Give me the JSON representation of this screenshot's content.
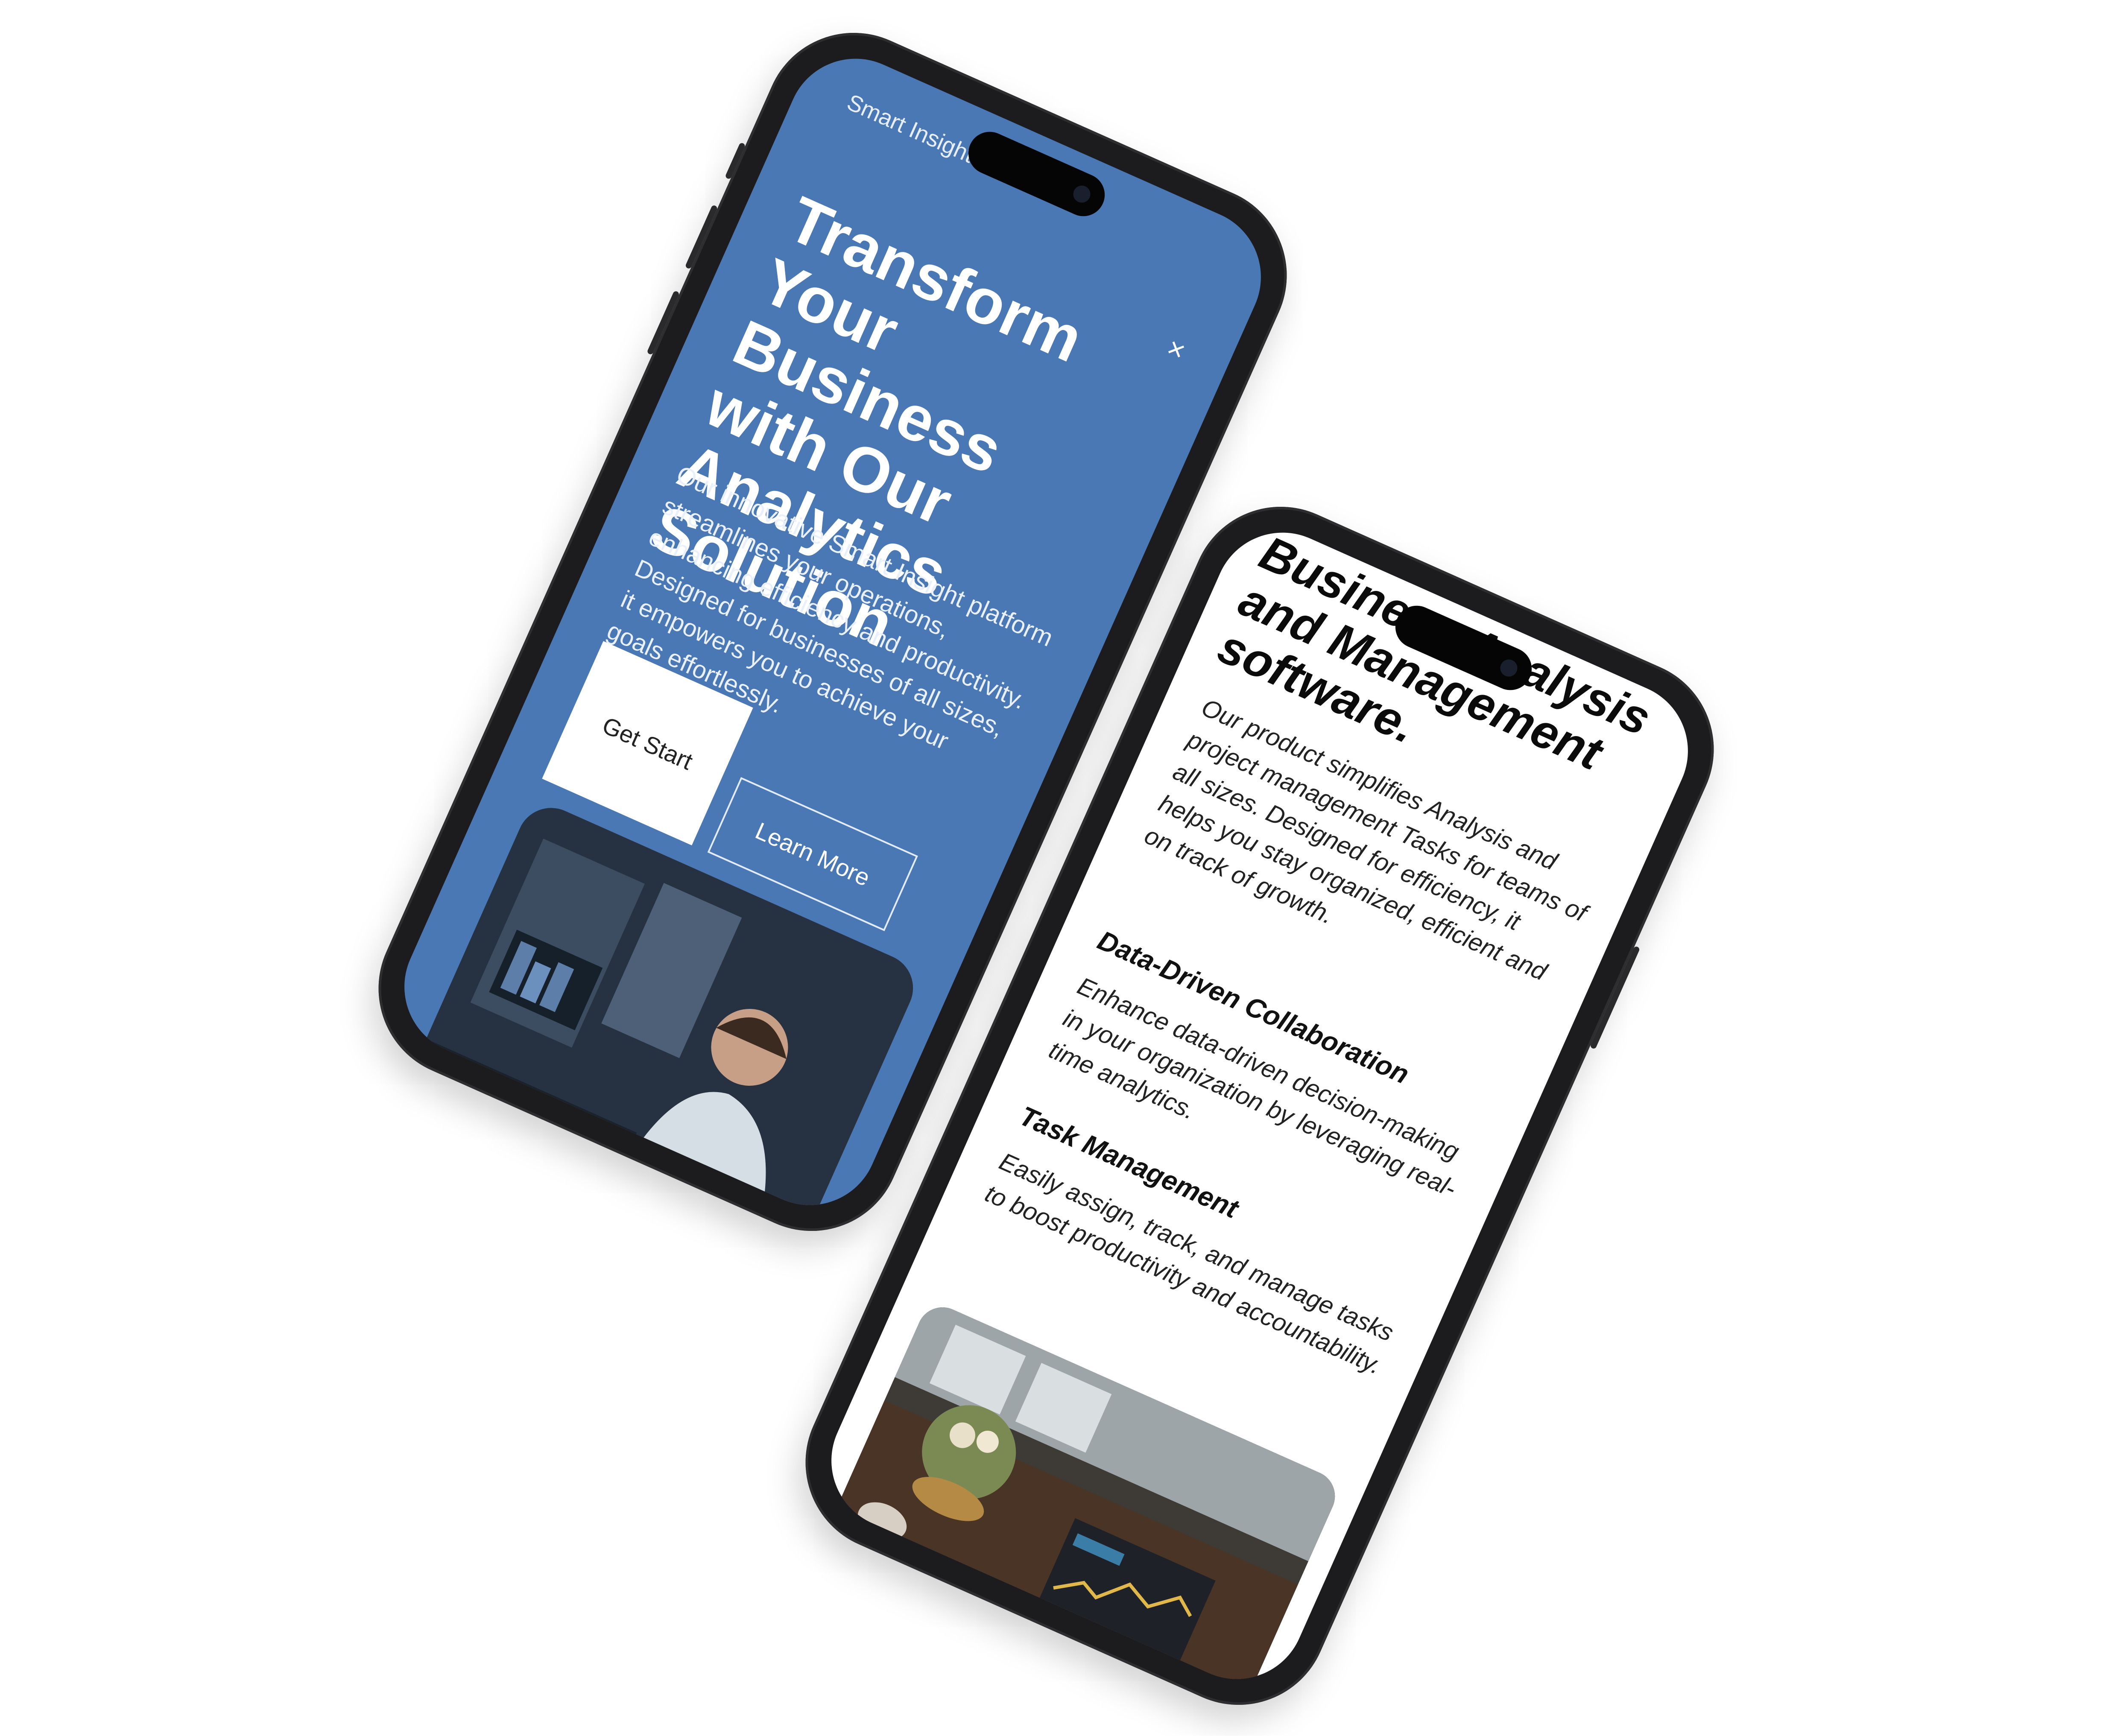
{
  "phone_1": {
    "brand": "Smart Insight",
    "close_icon": "×",
    "title": "Transform Your Business with Our Analytics Solution",
    "description": "Our innovative Smart Insight platform streamlines your operations, enhancing efficiency and productivity. Designed for businesses of all sizes, it empowers you to achieve your goals effortlessly.",
    "primary_button": "Get Start",
    "secondary_button": "Learn More",
    "image_icon": "office-analyst-photo",
    "colors": {
      "background": "#4a78b5",
      "text": "#ffffff"
    }
  },
  "phone_2": {
    "title": "Business Analysis and Management software.",
    "description": "Our product simplifies Analysis and project management Tasks for teams of all sizes. Designed for efficiency, it helps you stay organized, efficient and on track of growth.",
    "features": [
      {
        "heading": "Data-Driven Collaboration",
        "text": "Enhance data-driven decision-making in your organization by leveraging real-time analytics."
      },
      {
        "heading": "Task Management",
        "text": "Easily assign, track, and manage tasks to boost productivity and accountability."
      }
    ],
    "image_icon": "desk-laptop-dashboard-photo",
    "colors": {
      "background": "#ffffff",
      "text": "#111111"
    }
  }
}
